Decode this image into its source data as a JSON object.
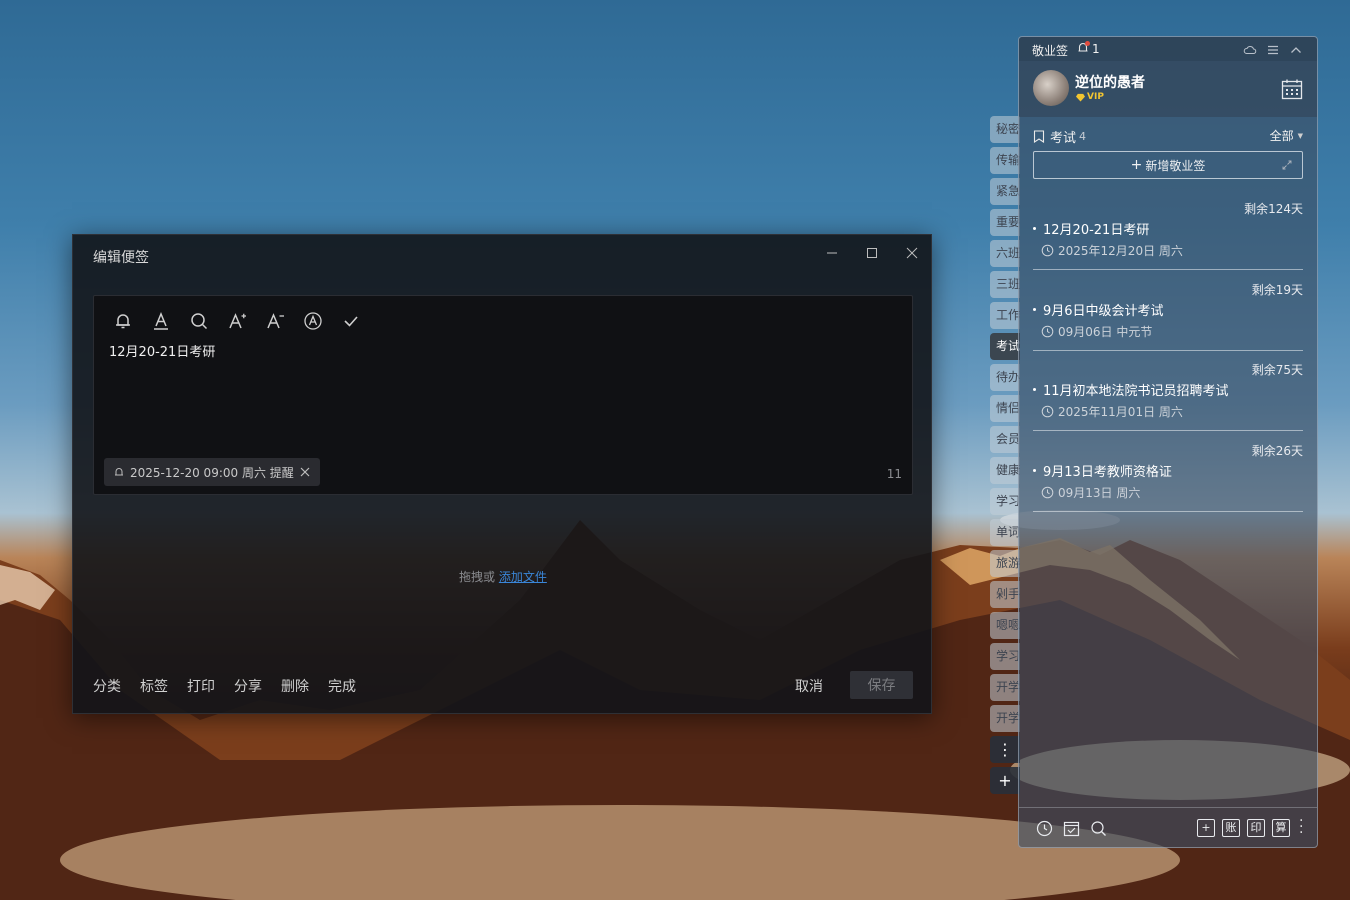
{
  "editor": {
    "title": "编辑便签",
    "window_controls": {
      "minimize": "—",
      "maximize": "☐",
      "close": "✕"
    },
    "toolbar_icons": [
      "bell-icon",
      "text-color-icon",
      "search-icon",
      "font-increase-icon",
      "font-decrease-icon",
      "text-style-icon",
      "check-icon"
    ],
    "note_text": "12月20-21日考研",
    "reminder": {
      "text": "2025-12-20 09:00 周六 提醒"
    },
    "char_count": "11",
    "drop_hint": {
      "prefix": "拖拽或",
      "link": "添加文件"
    },
    "actions": [
      "分类",
      "标签",
      "打印",
      "分享",
      "删除",
      "完成"
    ],
    "cancel_label": "取消",
    "save_label": "保存"
  },
  "tabs": [
    {
      "label": "秘密"
    },
    {
      "label": "传输"
    },
    {
      "label": "紧急"
    },
    {
      "label": "重要"
    },
    {
      "label": "六班"
    },
    {
      "label": "三班"
    },
    {
      "label": "工作"
    },
    {
      "label": "考试",
      "active": true
    },
    {
      "label": "待办"
    },
    {
      "label": "情侣"
    },
    {
      "label": "会员"
    },
    {
      "label": "健康"
    },
    {
      "label": "学习"
    },
    {
      "label": "单词"
    },
    {
      "label": "旅游"
    },
    {
      "label": "剁手"
    },
    {
      "label": "嗯嗯"
    },
    {
      "label": "学习"
    },
    {
      "label": "开学"
    },
    {
      "label": "开学"
    }
  ],
  "tab_more": "⋮",
  "tab_add": "+",
  "panel": {
    "app_name": "敬业签",
    "notification_count": "1",
    "user": {
      "name": "逆位的愚者",
      "badge": "VIP"
    },
    "category": {
      "name": "考试",
      "count": "4"
    },
    "filter": "全部",
    "add_button": "新增敬业签",
    "notes": [
      {
        "remaining": "剩余124天",
        "title": "12月20-21日考研",
        "date": "2025年12月20日 周六"
      },
      {
        "remaining": "剩余19天",
        "title": "9月6日中级会计考试",
        "date": "09月06日 中元节"
      },
      {
        "remaining": "剩余75天",
        "title": "11月初本地法院书记员招聘考试",
        "date": "2025年11月01日 周六"
      },
      {
        "remaining": "剩余26天",
        "title": "9月13日考教师资格证",
        "date": "09月13日 周六"
      }
    ],
    "bottom_boxes": [
      "+",
      "账",
      "印",
      "算"
    ],
    "accent_color": "#3a86d8",
    "alert_color": "#e24c3f",
    "vip_color": "#f2c530"
  }
}
